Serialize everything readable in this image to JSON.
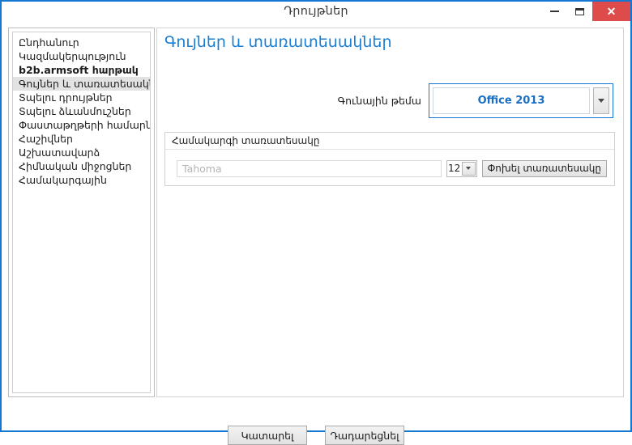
{
  "window": {
    "title": "Դրույթներ",
    "accent_color": "#1477d1",
    "controls": {
      "minimize": "minimize-icon",
      "maximize": "maximize-icon",
      "close": "✕",
      "close_color": "#dd4b4b"
    }
  },
  "sidebar": {
    "items": [
      {
        "label": "Ընդհանուր",
        "bold": false,
        "selected": false
      },
      {
        "label": "Կազմակերպություն",
        "bold": false,
        "selected": false
      },
      {
        "label": "b2b.armsoft հարթակ",
        "bold": true,
        "selected": false
      },
      {
        "label": "Գույներ և տառատեսակներ",
        "bold": false,
        "selected": true
      },
      {
        "label": "Տպելու դրույթներ",
        "bold": false,
        "selected": false
      },
      {
        "label": "Տպելու ձևանմուշներ",
        "bold": false,
        "selected": false
      },
      {
        "label": "Փաստաթղթերի համարներ",
        "bold": false,
        "selected": false
      },
      {
        "label": "Հաշիվներ",
        "bold": false,
        "selected": false
      },
      {
        "label": "Աշխատավարձ",
        "bold": false,
        "selected": false
      },
      {
        "label": "Հիմնական միջոցներ",
        "bold": false,
        "selected": false
      },
      {
        "label": "Համակարգային",
        "bold": false,
        "selected": false
      }
    ]
  },
  "main": {
    "title": "Գույներ և տառատեսակներ",
    "title_color": "#1a7fd4",
    "theme": {
      "label": "Գունային թեմա",
      "value": "Office 2013",
      "value_color": "#1a6fc4",
      "dropdown_icon": "chevron-down-icon"
    },
    "font_group": {
      "title": "Համակարգի տառատեսակը",
      "font_name": "Tahoma",
      "font_size": "12",
      "size_dropdown_icon": "chevron-down-icon",
      "change_button": "Փոխել տառատեսակը"
    }
  },
  "footer": {
    "ok_label": "Կատարել",
    "cancel_label": "Դադարեցնել"
  }
}
